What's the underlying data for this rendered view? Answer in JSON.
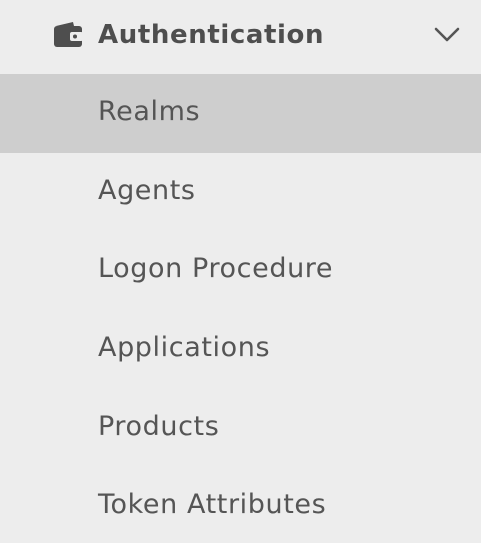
{
  "section": {
    "title": "Authentication",
    "icon": "wallet-icon",
    "toggle_icon": "chevron-down-icon",
    "expanded": true
  },
  "items": [
    {
      "label": "Realms",
      "selected": true
    },
    {
      "label": "Agents",
      "selected": false
    },
    {
      "label": "Logon Procedure",
      "selected": false
    },
    {
      "label": "Applications",
      "selected": false
    },
    {
      "label": "Products",
      "selected": false
    },
    {
      "label": "Token Attributes",
      "selected": false
    }
  ],
  "colors": {
    "background": "#ededed",
    "selected_background": "#cecece",
    "text": "#555555",
    "header_text": "#4e4e4e"
  }
}
